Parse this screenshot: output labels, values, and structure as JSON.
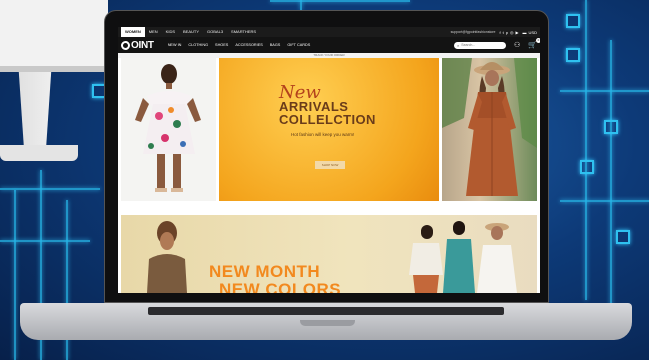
{
  "topbar": {
    "categories": [
      "WOMEN",
      "MEN",
      "KIDS",
      "BEAUTY",
      "GOBAL3",
      "SMARTHERS"
    ],
    "support_email": "support@fgpointfashionstore",
    "social_icons": [
      "facebook-icon",
      "twitter-icon",
      "pinterest-icon",
      "instagram-icon",
      "youtube-icon"
    ],
    "currency": "USD"
  },
  "navbar": {
    "logo": "OINT",
    "menu": [
      "NEW IN",
      "CLOTHING",
      "SHOES",
      "ACCESSORIES",
      "BAGS",
      "GIFT CARDS"
    ],
    "search_placeholder": "Search...",
    "cart_count": "0"
  },
  "tracking_bar": "TRACK YOUR ORDER",
  "hero": {
    "new_word": "New",
    "line1": "ARRIVALS",
    "line2": "COLLELCTION",
    "tagline": "Hot fashion will keep you warm!",
    "cta": "SHOP NOW"
  },
  "banner2": {
    "line1": "NEW MONTH",
    "line2": "NEW COLORS"
  },
  "colors": {
    "accent_orange": "#f2891e",
    "hero_brown": "#6a3c1a",
    "new_red": "#b3421c",
    "nav_black": "#131313"
  }
}
